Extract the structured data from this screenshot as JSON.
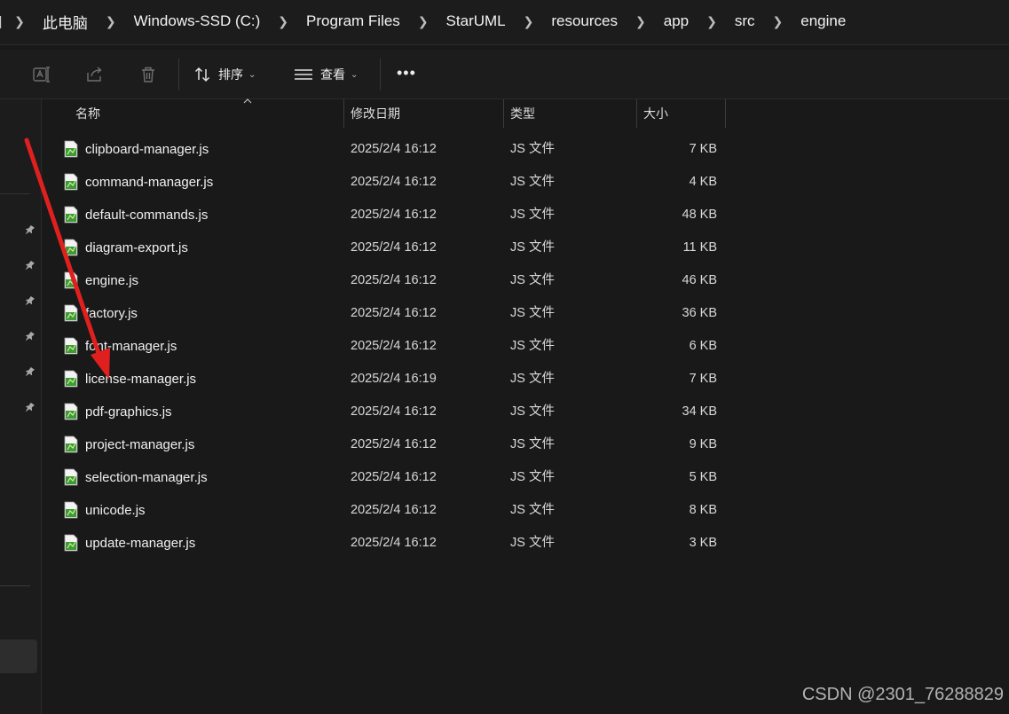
{
  "breadcrumb": {
    "items": [
      "此电脑",
      "Windows-SSD (C:)",
      "Program Files",
      "StarUML",
      "resources",
      "app",
      "src",
      "engine"
    ]
  },
  "toolbar": {
    "sort_label": "排序",
    "view_label": "查看",
    "more_label": "•••"
  },
  "columns": {
    "name": "名称",
    "modified": "修改日期",
    "type": "类型",
    "size": "大小"
  },
  "files": [
    {
      "name": "clipboard-manager.js",
      "modified": "2025/2/4 16:12",
      "type": "JS 文件",
      "size": "7 KB"
    },
    {
      "name": "command-manager.js",
      "modified": "2025/2/4 16:12",
      "type": "JS 文件",
      "size": "4 KB"
    },
    {
      "name": "default-commands.js",
      "modified": "2025/2/4 16:12",
      "type": "JS 文件",
      "size": "48 KB"
    },
    {
      "name": "diagram-export.js",
      "modified": "2025/2/4 16:12",
      "type": "JS 文件",
      "size": "11 KB"
    },
    {
      "name": "engine.js",
      "modified": "2025/2/4 16:12",
      "type": "JS 文件",
      "size": "46 KB"
    },
    {
      "name": "factory.js",
      "modified": "2025/2/4 16:12",
      "type": "JS 文件",
      "size": "36 KB"
    },
    {
      "name": "font-manager.js",
      "modified": "2025/2/4 16:12",
      "type": "JS 文件",
      "size": "6 KB"
    },
    {
      "name": "license-manager.js",
      "modified": "2025/2/4 16:19",
      "type": "JS 文件",
      "size": "7 KB"
    },
    {
      "name": "pdf-graphics.js",
      "modified": "2025/2/4 16:12",
      "type": "JS 文件",
      "size": "34 KB"
    },
    {
      "name": "project-manager.js",
      "modified": "2025/2/4 16:12",
      "type": "JS 文件",
      "size": "9 KB"
    },
    {
      "name": "selection-manager.js",
      "modified": "2025/2/4 16:12",
      "type": "JS 文件",
      "size": "5 KB"
    },
    {
      "name": "unicode.js",
      "modified": "2025/2/4 16:12",
      "type": "JS 文件",
      "size": "8 KB"
    },
    {
      "name": "update-manager.js",
      "modified": "2025/2/4 16:12",
      "type": "JS 文件",
      "size": "3 KB"
    }
  ],
  "watermark": "CSDN @2301_76288829",
  "colors": {
    "background": "#191919",
    "annotation_arrow": "#e0201f",
    "js_icon_green": "#3d9b35"
  }
}
